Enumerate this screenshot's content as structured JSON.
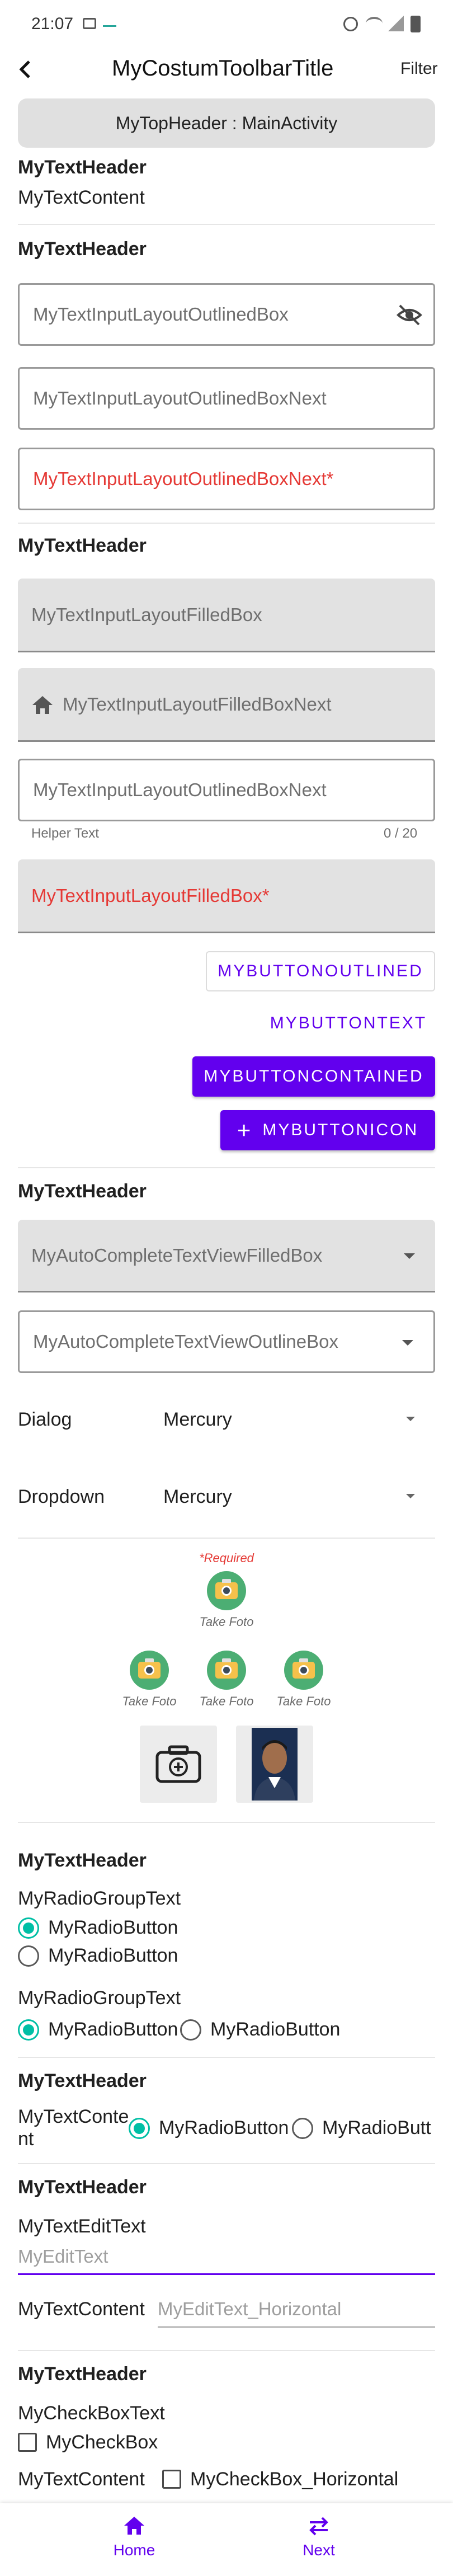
{
  "status_bar": {
    "time": "21:07"
  },
  "toolbar": {
    "title": "MyCostumToolbarTitle",
    "filter_label": "Filter"
  },
  "top_header": {
    "label": "MyTopHeader : MainActivity"
  },
  "section1": {
    "header": "MyTextHeader",
    "content": "MyTextContent"
  },
  "section2": {
    "header": "MyTextHeader",
    "outlined_box": "MyTextInputLayoutOutlinedBox",
    "outlined_box_next": "MyTextInputLayoutOutlinedBoxNext",
    "outlined_box_next_required": "MyTextInputLayoutOutlinedBoxNext*"
  },
  "section3": {
    "header": "MyTextHeader",
    "filled_box": "MyTextInputLayoutFilledBox",
    "filled_box_next": "MyTextInputLayoutFilledBoxNext",
    "outlined_box_next": "MyTextInputLayoutOutlinedBoxNext",
    "helper_text": "Helper Text",
    "counter": "0 / 20",
    "filled_box_required": "MyTextInputLayoutFilledBox*"
  },
  "buttons": {
    "outlined": "MYBUTTONOUTLINED",
    "text": "MYBUTTONTEXT",
    "contained": "MYBUTTONCONTAINED",
    "icon": "MYBUTTONICON"
  },
  "section4": {
    "header": "MyTextHeader",
    "autocomplete_filled": "MyAutoCompleteTextViewFilledBox",
    "autocomplete_outlined": "MyAutoCompleteTextViewOutlineBox",
    "dialog_label": "Dialog",
    "dialog_value": "Mercury",
    "dropdown_label": "Dropdown",
    "dropdown_value": "Mercury"
  },
  "photos": {
    "required": "*Required",
    "take_foto": "Take Foto",
    "take_foto_1": "Take Foto",
    "take_foto_2": "Take Foto",
    "take_foto_3": "Take Foto"
  },
  "section5": {
    "header": "MyTextHeader",
    "group1_label": "MyRadioGroupText",
    "group1_opt1": "MyRadioButton",
    "group1_opt2": "MyRadioButton",
    "group2_label": "MyRadioGroupText",
    "group2_opt1": "MyRadioButton",
    "group2_opt2": "MyRadioButton"
  },
  "section6": {
    "header": "MyTextHeader",
    "content_line1": "MyTextConte",
    "content_line2": "nt",
    "opt1": "MyRadioButton",
    "opt2": "MyRadioButt"
  },
  "section7": {
    "header": "MyTextHeader",
    "edit_label": "MyTextEditText",
    "edit_placeholder": "MyEditText",
    "content_label": "MyTextContent",
    "edit_horizontal_placeholder": "MyEditText_Horizontal"
  },
  "section8": {
    "header": "MyTextHeader",
    "checkbox_label": "MyCheckBoxText",
    "checkbox": "MyCheckBox",
    "content_label": "MyTextContent",
    "checkbox_horizontal": "MyCheckBox_Horizontal"
  },
  "bottom_nav": {
    "home": "Home",
    "next": "Next"
  },
  "colors": {
    "primary": "#6200ee",
    "radio_accent": "#00bfa5",
    "error": "#e53935",
    "photo_green": "#4cae73"
  }
}
